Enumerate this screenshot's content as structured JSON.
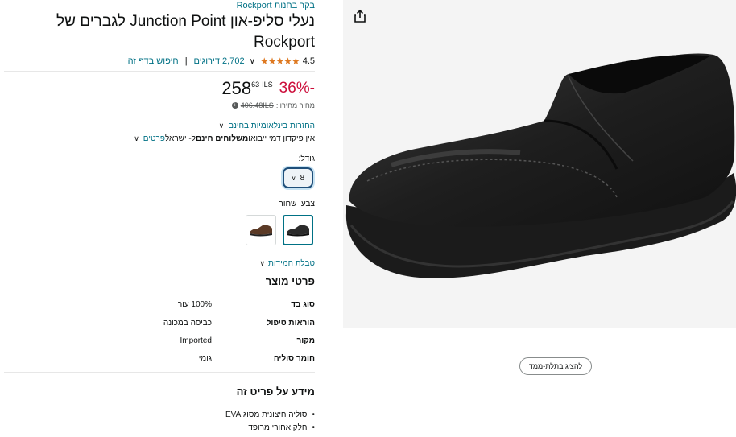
{
  "store_link": "בקר בחנות Rockport",
  "title": "נעלי סליפ-און Junction Point לגברים של Rockport",
  "rating": {
    "value": "4.5",
    "stars": "★★★★★",
    "count": "2,702 דירוגים",
    "search": "חיפוש בדף זה",
    "separator": "|"
  },
  "price": {
    "discount": "-36%",
    "whole": "258",
    "fraction": "63",
    "currency": "ILS"
  },
  "list_price": {
    "label": "מחיר מחירון:",
    "value": "406.48ILS",
    "info": "i"
  },
  "returns": "החזרות בינלאומיות בחינם",
  "shipping": {
    "prefix": "אין פיקדון דמי ייבוא ",
    "bold": "ומשלוחים חינם",
    "suffix": " ל- ישראל ",
    "link": "פרטים"
  },
  "size": {
    "label": "גודל:",
    "value": "8"
  },
  "color": {
    "label": "צבע:",
    "value": "שחור"
  },
  "size_chart": "טבלת המידות",
  "details": {
    "heading": "פרטי מוצר",
    "rows": [
      {
        "k": "סוג בד",
        "v": "100% עור"
      },
      {
        "k": "הוראות טיפול",
        "v": "כביסה במכונה"
      },
      {
        "k": "מקור",
        "v": "Imported"
      },
      {
        "k": "חומר סוליה",
        "v": "גומי"
      }
    ]
  },
  "about": {
    "heading": "מידע על פריט זה",
    "bullets": [
      "סוליה חיצונית מסוג EVA",
      "חלק אחורי מרופד"
    ]
  },
  "view3d": "להציג בתלת-ממד",
  "colors": {
    "link": "#007185",
    "discount": "#cc0c39",
    "star": "#de7921"
  }
}
